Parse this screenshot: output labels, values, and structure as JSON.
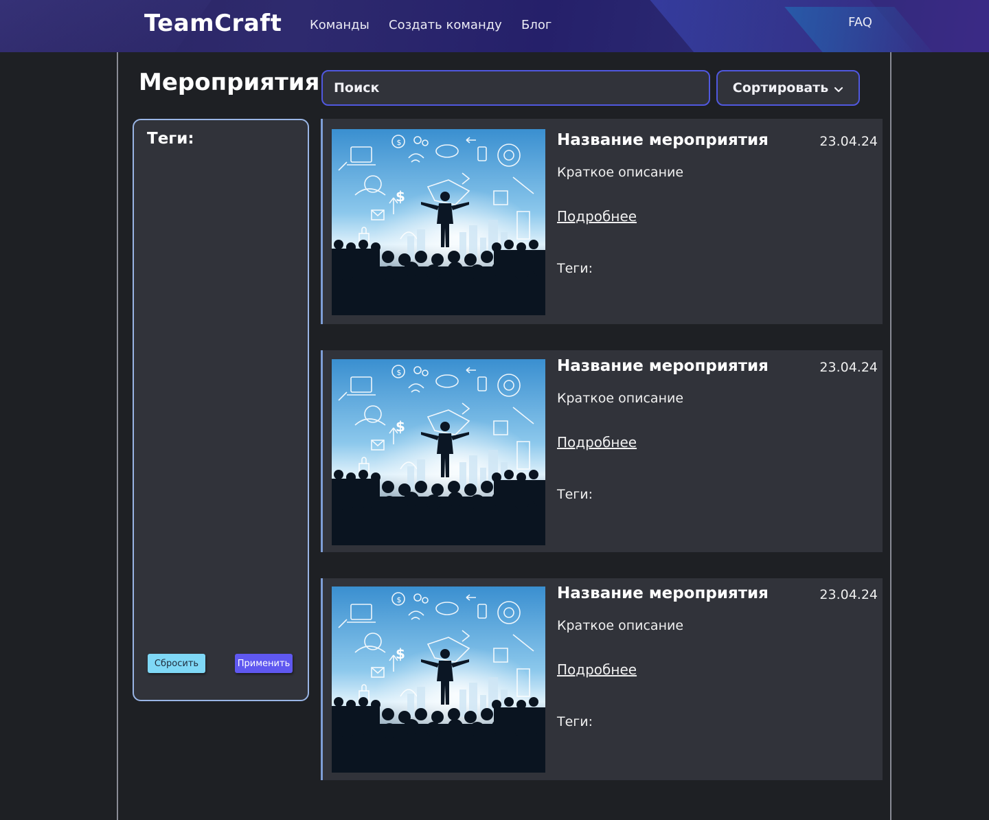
{
  "header": {
    "logo": "TeamCraft",
    "nav": [
      {
        "label": "Команды"
      },
      {
        "label": "Создать команду"
      },
      {
        "label": "Блог"
      }
    ],
    "faq": "FAQ"
  },
  "main": {
    "title": "Мероприятия",
    "search": {
      "placeholder": "Поиск"
    },
    "sort_label": "Сортировать"
  },
  "tags_panel": {
    "title": "Теги:",
    "reset_label": "Сбросить",
    "apply_label": "Применить"
  },
  "events": [
    {
      "title": "Название мероприятия",
      "date": "23.04.24",
      "description": "Краткое описание",
      "more": "Подробнее",
      "tags_label": "Теги:"
    },
    {
      "title": "Название мероприятия",
      "date": "23.04.24",
      "description": "Краткое описание",
      "more": "Подробнее",
      "tags_label": "Теги:"
    },
    {
      "title": "Название мероприятия",
      "date": "23.04.24",
      "description": "Краткое описание",
      "more": "Подробнее",
      "tags_label": "Теги:"
    }
  ],
  "colors": {
    "background": "#1e2024",
    "card": "#31333a",
    "accent_border": "#5058e0",
    "reset_button": "#7fd8f6",
    "apply_button": "#5f58f0"
  }
}
